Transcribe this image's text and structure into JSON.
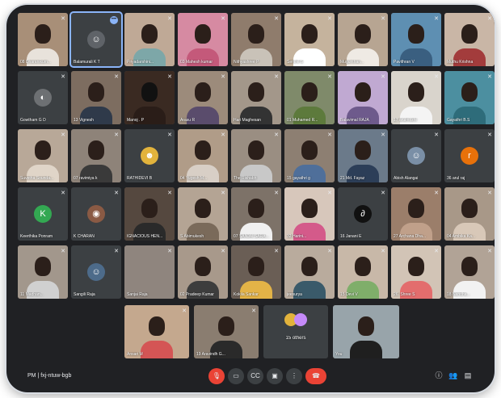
{
  "meeting": {
    "time": "PM",
    "code": "fxj-ntuw-bgb",
    "others_label": "15 others"
  },
  "rows": [
    [
      "08 Dharanikum...",
      "Balamurali K T",
      "Priyadarshini...",
      "03 Mahesh kumar",
      "Nithyashree P",
      "Senthil S",
      "Mugunthan...",
      "Pavithran V",
      "Muthu Krishna"
    ],
    [
      "Gowtham G D",
      "13 Vignesh",
      "Manoj . P",
      "Arasu R",
      "Hari Maghesan",
      "01 Muhamed R...",
      "Balavimal RAJA",
      "17 arulmozhi",
      "Gayathri B.S"
    ],
    [
      "Suvetha Sounda...",
      "07 ravimiya k",
      "RATHIDEVI B",
      "04 Yugesh M...",
      "The Rishabh",
      "15 gayathri g",
      "21 Md. Fayaz",
      "Abish Alangai",
      "36 arul raj"
    ],
    [
      "Keerthika Ponram",
      "K CHARAN",
      "IGNACIOUS HEN...",
      "S Abimukesh",
      "07 SANJAI SARA...",
      "32 Harini...",
      "16 Janani E",
      "27 Archana Dha...",
      "04 Ambika Ka..."
    ],
    [
      "11 Madhan...",
      "Sangili Raja",
      "Sanjai Raja",
      "02 Pradeep Kumar",
      "Kokila Sankar",
      "jeesurya",
      "15 Devi V",
      "26. Shree S",
      "18 Nandha..."
    ],
    [
      "Ansari M",
      "19 Aravindh G...",
      "15 others",
      "You"
    ]
  ]
}
